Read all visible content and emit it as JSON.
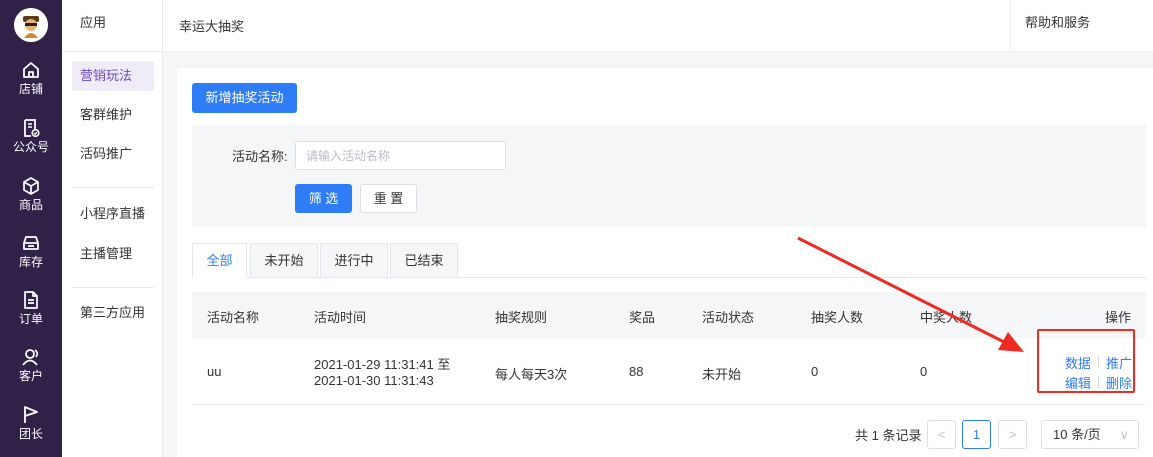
{
  "nav": {
    "items": [
      {
        "label": "店铺",
        "icon": "home-icon"
      },
      {
        "label": "公众号",
        "icon": "official-account-icon"
      },
      {
        "label": "商品",
        "icon": "product-box-icon"
      },
      {
        "label": "库存",
        "icon": "inventory-icon"
      },
      {
        "label": "订单",
        "icon": "order-document-icon"
      },
      {
        "label": "客户",
        "icon": "customer-icon"
      },
      {
        "label": "团长",
        "icon": "flag-icon"
      }
    ]
  },
  "submenu": {
    "header": "应用",
    "items": [
      "营销玩法",
      "客群维护",
      "活码推广",
      "小程序直播",
      "主播管理",
      "第三方应用"
    ]
  },
  "topbar": {
    "title": "幸运大抽奖",
    "help": "帮助和服务"
  },
  "actions": {
    "new_button": "新增抽奖活动"
  },
  "filter": {
    "label": "活动名称:",
    "placeholder": "请输入活动名称",
    "search_button": "筛 选",
    "reset_button": "重 置"
  },
  "tabs": [
    "全部",
    "未开始",
    "进行中",
    "已结束"
  ],
  "table": {
    "headers": [
      "活动名称",
      "活动时间",
      "抽奖规则",
      "奖品",
      "活动状态",
      "抽奖人数",
      "中奖人数",
      "操作"
    ],
    "rows": [
      {
        "name": "uu",
        "time_start": "2021-01-29 11:31:41 至",
        "time_end": "2021-01-30 11:31:43",
        "rule": "每人每天3次",
        "prize": "88",
        "status": "未开始",
        "draw_count": "0",
        "win_count": "0",
        "ops": [
          "数据",
          "推广",
          "编辑",
          "删除"
        ]
      }
    ]
  },
  "pagination": {
    "total": "共 1 条记录",
    "current_page": "1",
    "prev": "<",
    "next": ">",
    "page_size": "10 条/页",
    "caret": "∨"
  },
  "colors": {
    "nav_bg": "#2f2148",
    "primary": "#2f7df6",
    "submenu_active": "#6c48c4",
    "annotation": "#ee2a23"
  }
}
